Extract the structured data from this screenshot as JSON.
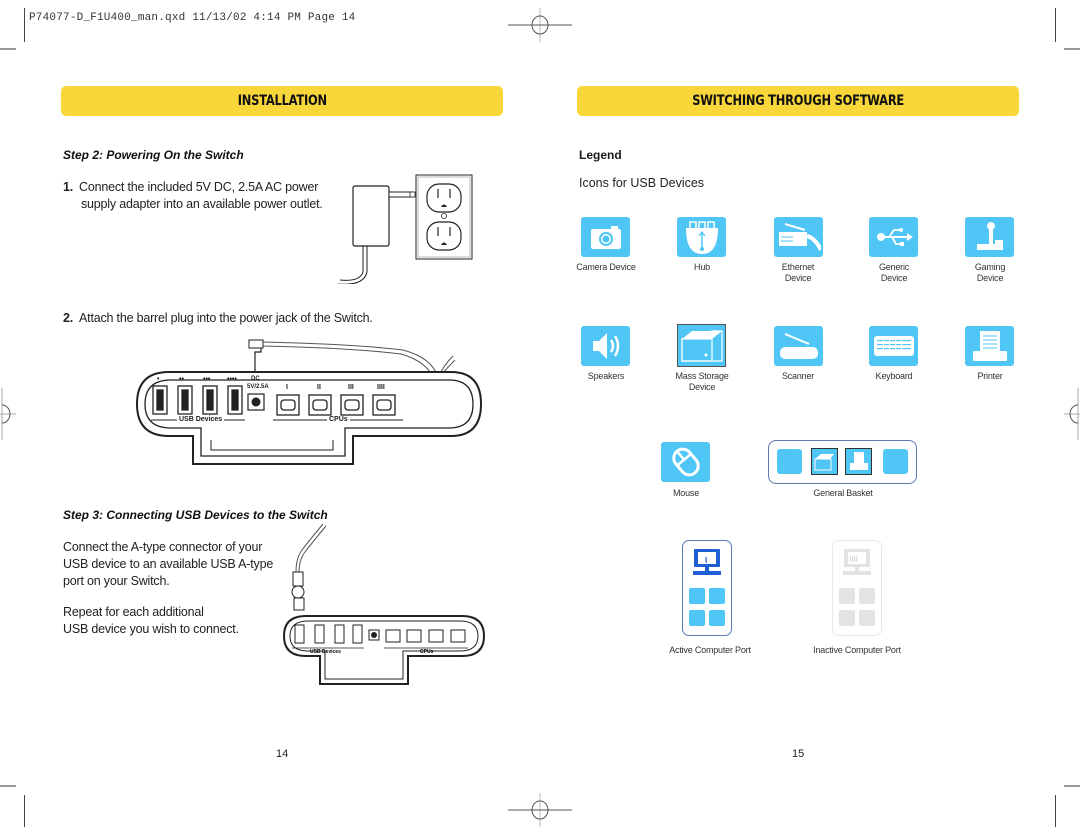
{
  "slug": "P74077-D_F1U400_man.qxd  11/13/02  4:14 PM  Page 14",
  "left_page": {
    "banner": "INSTALLATION",
    "step2": {
      "title": "Step 2: Powering On the Switch",
      "item1_num": "1.",
      "item1_line1": "Connect the included 5V DC, 2.5A AC power",
      "item1_line2": "supply adapter into an available power outlet.",
      "item2_num": "2.",
      "item2_text": "Attach the barrel plug into the power jack of the Switch."
    },
    "switch_diagram": {
      "port_marks": [
        "•",
        "••",
        "•••",
        "••••"
      ],
      "dc_label": "DC",
      "dc_rating": "5V/2.5A",
      "cpu_marks": [
        "I",
        "II",
        "III",
        "IIII"
      ],
      "usb_group_label": "USB Devices",
      "cpu_group_label": "CPUs"
    },
    "step3": {
      "title": "Step 3: Connecting USB Devices to the Switch",
      "para1_line1": "Connect the A-type connector of your",
      "para1_line2": "USB device to an available USB A-type",
      "para1_line3": "port on your Switch.",
      "para2_line1": "Repeat for each additional",
      "para2_line2": "USB device you wish to connect."
    },
    "page_number": "14"
  },
  "right_page": {
    "banner": "SWITCHING THROUGH SOFTWARE",
    "legend_title": "Legend",
    "subtitle": "Icons for USB Devices",
    "icons_row1": [
      {
        "icon": "camera-icon",
        "label1": "Camera Device",
        "label2": ""
      },
      {
        "icon": "hub-icon",
        "label1": "Hub",
        "label2": ""
      },
      {
        "icon": "ethernet-icon",
        "label1": "Ethernet",
        "label2": "Device"
      },
      {
        "icon": "usb-generic-icon",
        "label1": "Generic",
        "label2": "Device"
      },
      {
        "icon": "joystick-icon",
        "label1": "Gaming",
        "label2": "Device"
      }
    ],
    "icons_row2": [
      {
        "icon": "speaker-icon",
        "label1": "Speakers",
        "label2": ""
      },
      {
        "icon": "mass-storage-icon",
        "label1": "Mass Storage",
        "label2": "Device"
      },
      {
        "icon": "scanner-icon",
        "label1": "Scanner",
        "label2": ""
      },
      {
        "icon": "keyboard-icon",
        "label1": "Keyboard",
        "label2": ""
      },
      {
        "icon": "printer-icon",
        "label1": "Printer",
        "label2": ""
      }
    ],
    "mouse_label": "Mouse",
    "basket_label": "General Basket",
    "active_port_label": "Active Computer Port",
    "inactive_port_label": "Inactive Computer Port",
    "active_port_mark": "I",
    "inactive_port_mark": "IIII",
    "page_number": "15"
  },
  "colors": {
    "banner": "#f9d63a",
    "icon_tile": "#4fc6f6",
    "active_blue": "#1f5fd6",
    "basket_border": "#5c7ab0",
    "inactive_gray": "#e3e3e3"
  }
}
